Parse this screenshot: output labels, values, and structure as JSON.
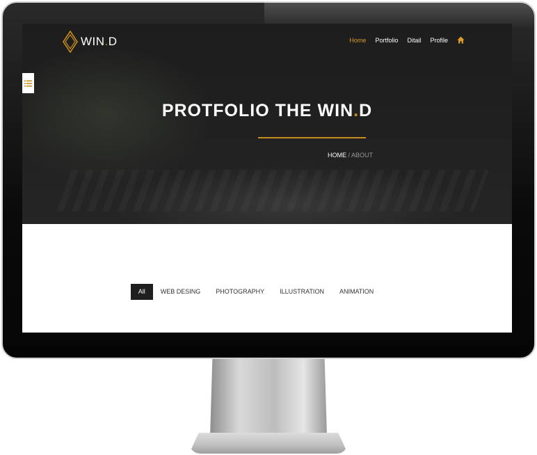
{
  "site": {
    "logo": {
      "text": "WIN",
      "dot": ".",
      "suffix": "D"
    },
    "nav": {
      "items": [
        {
          "label": "Home",
          "active": true
        },
        {
          "label": "Portfolio",
          "active": false
        },
        {
          "label": "Ditail",
          "active": false
        },
        {
          "label": "Profile",
          "active": false
        }
      ],
      "home_icon": "home-icon"
    },
    "side_toggle_icon": "list-icon"
  },
  "hero": {
    "title_prefix": "PROTFOLIO THE WIN",
    "title_dot": ".",
    "title_suffix": "D",
    "breadcrumb": {
      "home": "HOME",
      "sep": " / ",
      "current": "ABOUT"
    }
  },
  "filters": [
    {
      "label": "All",
      "active": true
    },
    {
      "label": "WEB DESING",
      "active": false
    },
    {
      "label": "PHOTOGRAPHY",
      "active": false
    },
    {
      "label": "ILLUSTRATION",
      "active": false
    },
    {
      "label": "ANIMATION",
      "active": false
    }
  ],
  "colors": {
    "accent": "#c78c1e",
    "nav_active": "#d99a2b",
    "hero_bg": "#1f1f1f",
    "filter_active_bg": "#1f1f1f"
  }
}
